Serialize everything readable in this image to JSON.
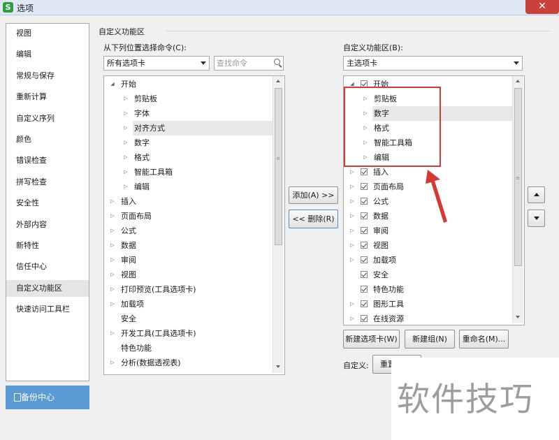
{
  "window": {
    "title": "选项",
    "app_icon_letter": "S",
    "close_glyph": "✕"
  },
  "nav": {
    "items": [
      "视图",
      "编辑",
      "常规与保存",
      "重新计算",
      "自定义序列",
      "颜色",
      "错误检查",
      "拼写检查",
      "安全性",
      "外部内容",
      "新特性",
      "信任中心",
      "自定义功能区",
      "快速访问工具栏"
    ],
    "selected": "自定义功能区",
    "backup_label": "备份中心"
  },
  "section": {
    "title": "自定义功能区"
  },
  "left": {
    "label": "从下列位置选择命令(C):",
    "combo_value": "所有选项卡",
    "search_placeholder": "查找命令",
    "tree": [
      {
        "text": "开始",
        "level": 0,
        "state": "open"
      },
      {
        "text": "剪贴板",
        "level": 1,
        "state": "closed"
      },
      {
        "text": "字体",
        "level": 1,
        "state": "closed"
      },
      {
        "text": "对齐方式",
        "level": 1,
        "state": "closed",
        "highlight": true
      },
      {
        "text": "数字",
        "level": 1,
        "state": "closed"
      },
      {
        "text": "格式",
        "level": 1,
        "state": "closed"
      },
      {
        "text": "智能工具箱",
        "level": 1,
        "state": "closed"
      },
      {
        "text": "编辑",
        "level": 1,
        "state": "closed"
      },
      {
        "text": "插入",
        "level": 0,
        "state": "closed"
      },
      {
        "text": "页面布局",
        "level": 0,
        "state": "closed"
      },
      {
        "text": "公式",
        "level": 0,
        "state": "closed"
      },
      {
        "text": "数据",
        "level": 0,
        "state": "closed"
      },
      {
        "text": "审阅",
        "level": 0,
        "state": "closed"
      },
      {
        "text": "视图",
        "level": 0,
        "state": "closed"
      },
      {
        "text": "打印预览(工具选项卡)",
        "level": 0,
        "state": "closed"
      },
      {
        "text": "加载项",
        "level": 0,
        "state": "closed"
      },
      {
        "text": "安全",
        "level": 0,
        "state": "none"
      },
      {
        "text": "开发工具(工具选项卡)",
        "level": 0,
        "state": "closed"
      },
      {
        "text": "特色功能",
        "level": 0,
        "state": "none"
      },
      {
        "text": "分析(数据透视表)",
        "level": 0,
        "state": "closed"
      }
    ]
  },
  "middle": {
    "add_label": "添加(A) >>",
    "remove_label": "<< 删除(R)"
  },
  "right": {
    "label": "自定义功能区(B):",
    "combo_value": "主选项卡",
    "tree": [
      {
        "text": "开始",
        "level": 0,
        "state": "open",
        "checked": true
      },
      {
        "text": "剪贴板",
        "level": 1,
        "state": "closed"
      },
      {
        "text": "数字",
        "level": 1,
        "state": "closed",
        "highlight": true
      },
      {
        "text": "格式",
        "level": 1,
        "state": "closed"
      },
      {
        "text": "智能工具箱",
        "level": 1,
        "state": "closed"
      },
      {
        "text": "编辑",
        "level": 1,
        "state": "closed"
      },
      {
        "text": "插入",
        "level": 0,
        "state": "closed",
        "checked": true
      },
      {
        "text": "页面布局",
        "level": 0,
        "state": "closed",
        "checked": true
      },
      {
        "text": "公式",
        "level": 0,
        "state": "closed",
        "checked": true
      },
      {
        "text": "数据",
        "level": 0,
        "state": "closed",
        "checked": true
      },
      {
        "text": "审阅",
        "level": 0,
        "state": "closed",
        "checked": true
      },
      {
        "text": "视图",
        "level": 0,
        "state": "closed",
        "checked": true
      },
      {
        "text": "加载项",
        "level": 0,
        "state": "closed",
        "checked": true
      },
      {
        "text": "安全",
        "level": 0,
        "state": "none",
        "checked": true
      },
      {
        "text": "特色功能",
        "level": 0,
        "state": "none",
        "checked": true
      },
      {
        "text": "图形工具",
        "level": 0,
        "state": "closed",
        "checked": true
      },
      {
        "text": "在线资源",
        "level": 0,
        "state": "closed",
        "checked": true
      }
    ],
    "new_tab_label": "新建选项卡(W)",
    "new_group_label": "新建组(N)",
    "rename_label": "重命名(M)...",
    "customize_label": "自定义:",
    "reset_label": "重置"
  },
  "watermark": {
    "text": "软件技巧"
  },
  "colors": {
    "accent": "#5b9bd5",
    "annotation": "#d43a32"
  }
}
